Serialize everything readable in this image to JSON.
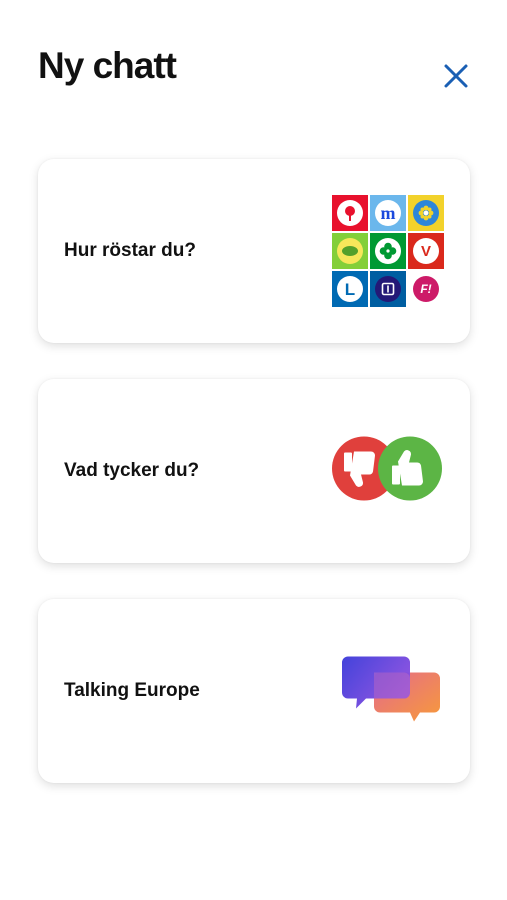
{
  "header": {
    "title": "Ny chatt"
  },
  "icons": {
    "close": "close-icon",
    "party_grid": "party-logos-grid-icon",
    "thumbs": "thumbs-up-down-icon",
    "chat": "chat-bubbles-icon"
  },
  "cards": [
    {
      "label": "Hur röstar du?"
    },
    {
      "label": "Vad tycker du?"
    },
    {
      "label": "Talking Europe"
    }
  ],
  "party_logos": {
    "m": "m",
    "v": "V",
    "l": "L",
    "f": "F!"
  },
  "colors": {
    "accent": "#1a5fb4",
    "card_shadow": "rgba(0,0,0,0.13)",
    "thumbs_down": "#e0403c",
    "thumbs_up": "#5cb545",
    "chat_front_start": "#3b3bd9",
    "chat_front_end": "#9b4fd8",
    "chat_back": "#f7943e"
  }
}
